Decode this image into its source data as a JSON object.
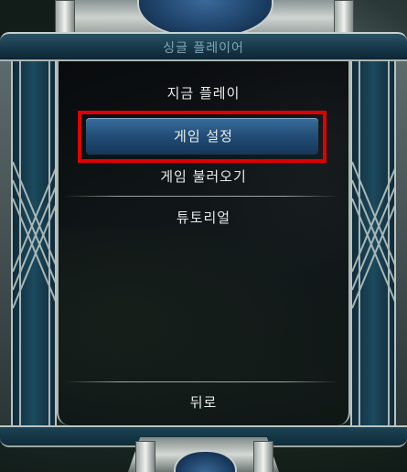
{
  "window": {
    "title": "싱글 플레이어"
  },
  "menu": {
    "items": [
      {
        "label": "지금 플레이"
      },
      {
        "label": "게임 설정",
        "selected": true
      },
      {
        "label": "게임 불러오기"
      },
      {
        "label": "튜토리얼"
      }
    ],
    "back_label": "뒤로"
  },
  "colors": {
    "highlight_outline": "#e00000",
    "selected_item": "#2a5a86",
    "frame_teal": "#17384a"
  }
}
